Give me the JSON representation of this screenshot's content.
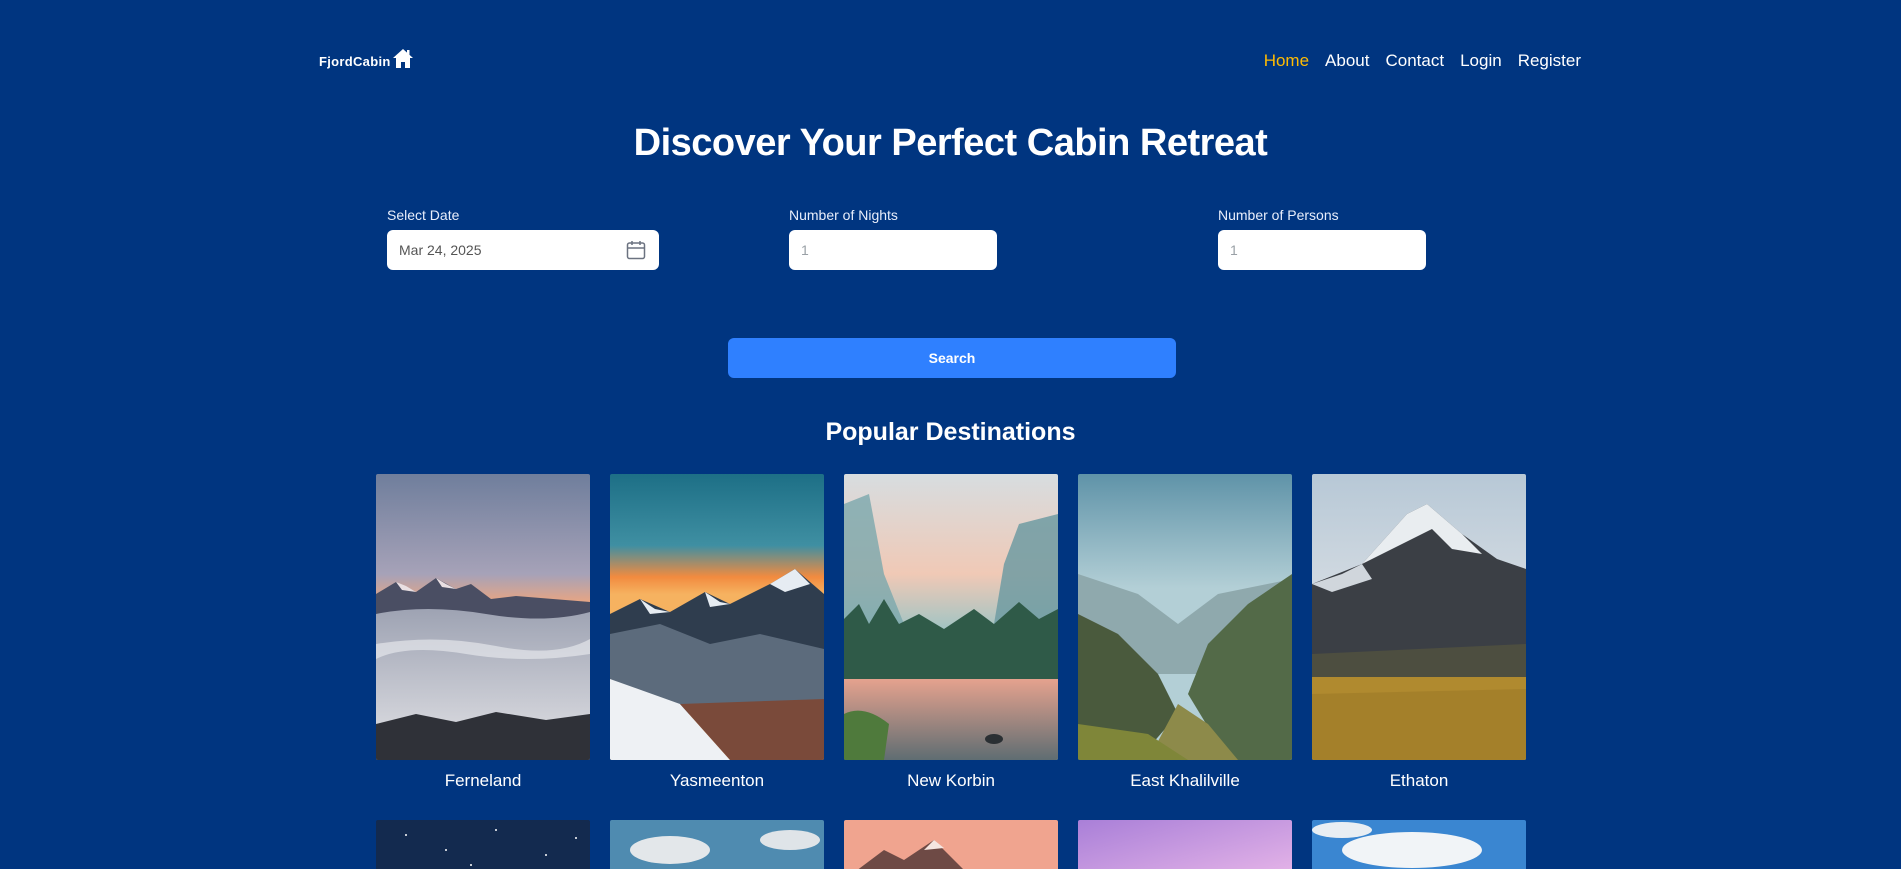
{
  "header": {
    "logo_text": "FjordCabin",
    "logo_icon": "house-icon",
    "nav": [
      {
        "label": "Home",
        "active": true
      },
      {
        "label": "About",
        "active": false
      },
      {
        "label": "Contact",
        "active": false
      },
      {
        "label": "Login",
        "active": false
      },
      {
        "label": "Register",
        "active": false
      }
    ]
  },
  "hero": {
    "title": "Discover Your Perfect Cabin Retreat"
  },
  "search_form": {
    "date_label": "Select Date",
    "date_value": "Mar 24, 2025",
    "date_icon": "calendar-icon",
    "nights_label": "Number of Nights",
    "nights_placeholder": "1",
    "persons_label": "Number of Persons",
    "persons_placeholder": "1",
    "search_label": "Search"
  },
  "destinations": {
    "title": "Popular Destinations",
    "items": [
      {
        "name": "Ferneland"
      },
      {
        "name": "Yasmeenton"
      },
      {
        "name": "New Korbin"
      },
      {
        "name": "East Khalilville"
      },
      {
        "name": "Ethaton"
      }
    ]
  },
  "colors": {
    "background": "#003580",
    "accent": "#febb02",
    "button": "#2f80ff"
  }
}
